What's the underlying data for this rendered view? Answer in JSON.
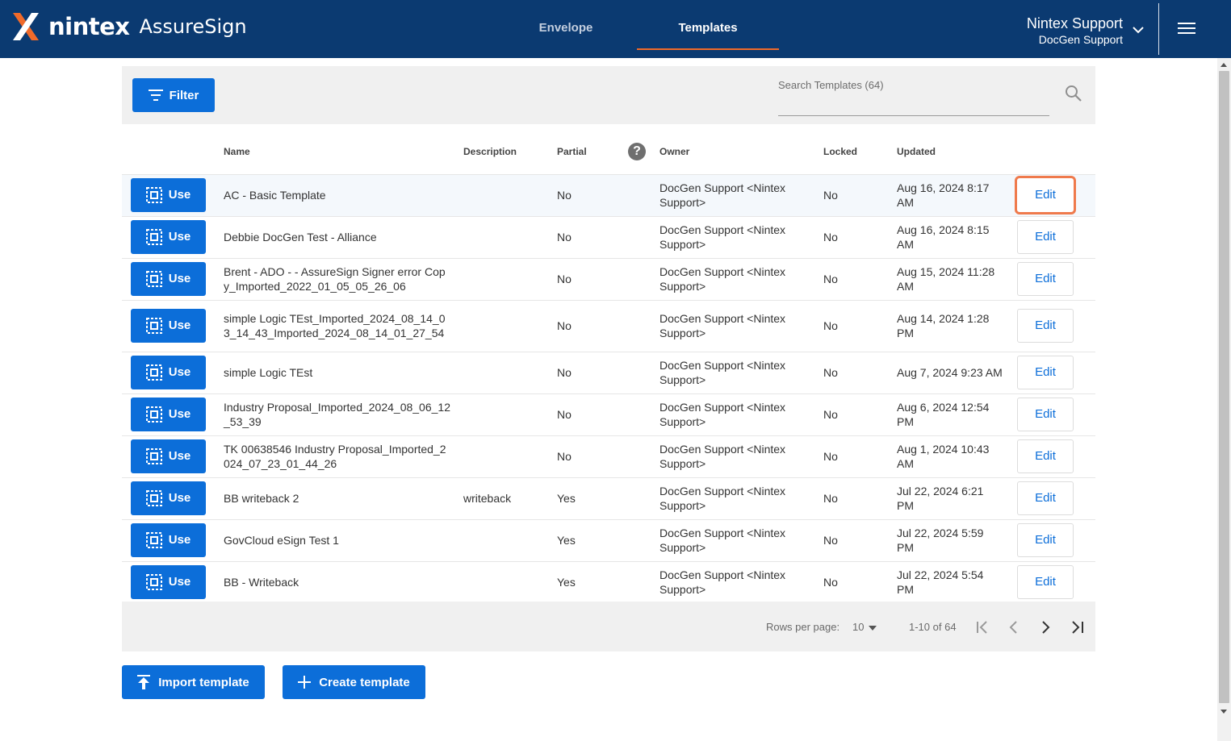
{
  "header": {
    "brand": "nintex",
    "product": "AssureSign",
    "tabs": [
      {
        "label": "Envelope",
        "active": false
      },
      {
        "label": "Templates",
        "active": true
      }
    ],
    "user_name": "Nintex Support",
    "user_org": "DocGen Support"
  },
  "toolbar": {
    "filter_label": "Filter",
    "search_placeholder": "Search Templates (64)"
  },
  "columns": {
    "name": "Name",
    "description": "Description",
    "partial": "Partial",
    "owner": "Owner",
    "locked": "Locked",
    "updated": "Updated"
  },
  "rows": [
    {
      "use": "Use",
      "name": "AC - Basic Template",
      "description": "",
      "partial": "No",
      "owner": "DocGen Support <Nintex Support>",
      "locked": "No",
      "updated": "Aug 16, 2024 8:17 AM",
      "edit": "Edit"
    },
    {
      "use": "Use",
      "name": "Debbie DocGen Test - Alliance",
      "description": "",
      "partial": "No",
      "owner": "DocGen Support <Nintex Support>",
      "locked": "No",
      "updated": "Aug 16, 2024 8:15 AM",
      "edit": "Edit"
    },
    {
      "use": "Use",
      "name": "Brent - ADO - - AssureSign Signer error Copy_Imported_2022_01_05_05_26_06",
      "description": "",
      "partial": "No",
      "owner": "DocGen Support <Nintex Support>",
      "locked": "No",
      "updated": "Aug 15, 2024 11:28 AM",
      "edit": "Edit"
    },
    {
      "use": "Use",
      "name": "simple Logic TEst_Imported_2024_08_14_03_14_43_Imported_2024_08_14_01_27_54",
      "description": "",
      "partial": "No",
      "owner": "DocGen Support <Nintex Support>",
      "locked": "No",
      "updated": "Aug 14, 2024 1:28 PM",
      "edit": "Edit"
    },
    {
      "use": "Use",
      "name": "simple Logic TEst",
      "description": "",
      "partial": "No",
      "owner": "DocGen Support <Nintex Support>",
      "locked": "No",
      "updated": "Aug 7, 2024 9:23 AM",
      "edit": "Edit"
    },
    {
      "use": "Use",
      "name": "Industry Proposal_Imported_2024_08_06_12_53_39",
      "description": "",
      "partial": "No",
      "owner": "DocGen Support <Nintex Support>",
      "locked": "No",
      "updated": "Aug 6, 2024 12:54 PM",
      "edit": "Edit"
    },
    {
      "use": "Use",
      "name": "TK 00638546 Industry Proposal_Imported_2024_07_23_01_44_26",
      "description": "",
      "partial": "No",
      "owner": "DocGen Support <Nintex Support>",
      "locked": "No",
      "updated": "Aug 1, 2024 10:43 AM",
      "edit": "Edit"
    },
    {
      "use": "Use",
      "name": "BB writeback 2",
      "description": "writeback",
      "partial": "Yes",
      "owner": "DocGen Support <Nintex Support>",
      "locked": "No",
      "updated": "Jul 22, 2024 6:21 PM",
      "edit": "Edit"
    },
    {
      "use": "Use",
      "name": "GovCloud eSign Test 1",
      "description": "",
      "partial": "Yes",
      "owner": "DocGen Support <Nintex Support>",
      "locked": "No",
      "updated": "Jul 22, 2024 5:59 PM",
      "edit": "Edit"
    },
    {
      "use": "Use",
      "name": "BB - Writeback",
      "description": "",
      "partial": "Yes",
      "owner": "DocGen Support <Nintex Support>",
      "locked": "No",
      "updated": "Jul 22, 2024 5:54 PM",
      "edit": "Edit"
    }
  ],
  "pager": {
    "rows_per_page_label": "Rows per page:",
    "rows_per_page_value": "10",
    "range": "1-10 of 64"
  },
  "actions": {
    "import_label": "Import template",
    "create_label": "Create template"
  },
  "colors": {
    "header_bg": "#0b3a71",
    "primary": "#0c6ed9",
    "accent": "#f06a2a"
  }
}
